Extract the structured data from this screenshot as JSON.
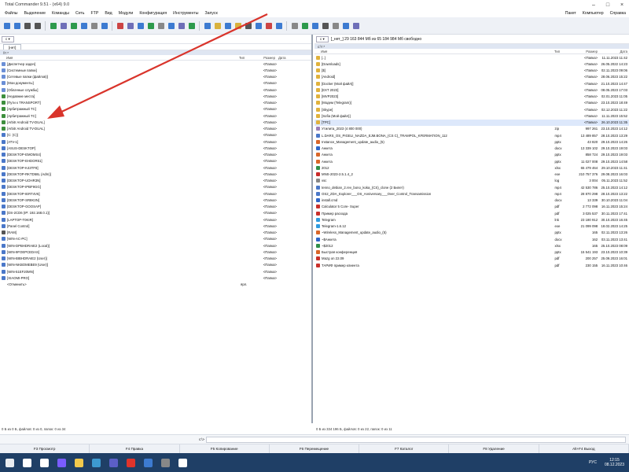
{
  "window": {
    "title": "Total Commander 9.51 - (x64) 9.0"
  },
  "menu": {
    "items": [
      "Файлы",
      "Выделение",
      "Команды",
      "Сеть",
      "FTP",
      "Вид",
      "Модули",
      "Конфигурация",
      "Инструменты",
      "Запуск"
    ],
    "right_items": [
      "Пакет",
      "Компьютер",
      "Справка"
    ]
  },
  "left": {
    "drive_label": "c",
    "path_box": "",
    "tab_label": "[нет]",
    "current_path": "\\\\*.*",
    "columns": {
      "name": "Имя",
      "ext": "Тип",
      "size": "Размер",
      "date": "Дата"
    },
    "rows": [
      {
        "name": "[Диспетчер задач]",
        "size": "<Папка>",
        "color": "#6b8fd6"
      },
      {
        "name": "[Системные папки]",
        "size": "<Папка>",
        "color": "#6b8fd6"
      },
      {
        "name": "[Сетевые папки (файлов)]",
        "size": "<Папка>",
        "color": "#6b8fd6"
      },
      {
        "name": "[Мои документы]",
        "size": "<Папка>",
        "color": "#6b8fd6"
      },
      {
        "name": "[Облачные службы]",
        "size": "<Папка>",
        "color": "#6b8fd6"
      },
      {
        "name": "[Недавние места]",
        "size": "<Папка>",
        "color": "#3e8f3e"
      },
      {
        "name": "[Пути к TRANSPORT]",
        "size": "<Папка>",
        "color": "#3e8f3e"
      },
      {
        "name": "[Арбитражный TC]",
        "size": "<Папка>",
        "color": "#3e8f3e"
      },
      {
        "name": "[Арбитражный TC]",
        "size": "<Папка>",
        "color": "#3e8f3e"
      },
      {
        "name": "[Arbitr Android TV-DUAL]",
        "size": "<Папка>",
        "color": "#3e8f3e"
      },
      {
        "name": "[Arbitr Android TV-DUAL]",
        "size": "<Папка>",
        "color": "#3e8f3e"
      },
      {
        "name": "[C: (C)]",
        "size": "<Папка>",
        "color": "#4b78c9"
      },
      {
        "name": "[ATV-1]",
        "size": "<Папка>",
        "color": "#4b78c9"
      },
      {
        "name": "[ASUS-DESKTOP]",
        "size": "<Папка>",
        "color": "#4b78c9"
      },
      {
        "name": "[DESKTOP-EMOMS4]",
        "size": "<Папка>",
        "color": "#4b78c9"
      },
      {
        "name": "[DESKTOP-EHDOR51]",
        "size": "<Папка>",
        "color": "#4b78c9"
      },
      {
        "name": "[DESKTOP-K43TF8]",
        "size": "<Папка>",
        "color": "#4b78c9"
      },
      {
        "name": "[DESKTOP-RKTD58L (Adm)]",
        "size": "<Папка>",
        "color": "#4b78c9"
      },
      {
        "name": "[DESKTOP-UOHR3N]",
        "size": "<Папка>",
        "color": "#4b78c9"
      },
      {
        "name": "[DESKTOP-IPBF9GG]",
        "size": "<Папка>",
        "color": "#4b78c9"
      },
      {
        "name": "[DESKTOP-IERT4V6]",
        "size": "<Папка>",
        "color": "#4b78c9"
      },
      {
        "name": "[DESKTOP-SR8K3N]",
        "size": "<Папка>",
        "color": "#4b78c9"
      },
      {
        "name": "[DESKTOP-GOOSAP]",
        "size": "<Папка>",
        "color": "#4b78c9"
      },
      {
        "name": "[DS-2CD6 (IP: 192.168.0.1)]",
        "size": "<Папка>",
        "color": "#4b78c9"
      },
      {
        "name": "[LAPTOP-T0KIR]",
        "size": "<Папка>",
        "color": "#4b78c9"
      },
      {
        "name": "[Panel Control]",
        "size": "<Папка>",
        "color": "#4b78c9"
      },
      {
        "name": "[RAM]",
        "size": "<Папка>",
        "color": "#555555"
      },
      {
        "name": "[WIN-AC-PC]",
        "size": "<Папка>",
        "color": "#4b78c9"
      },
      {
        "name": "[WIN-DPBHDRAIE2 (Local)]",
        "size": "<Папка>",
        "color": "#4b78c9"
      },
      {
        "name": "[WIN-9FOEPCEDAS]",
        "size": "<Папка>",
        "color": "#4b78c9"
      },
      {
        "name": "[WIN-BIBHDRAIE2 (User)]",
        "size": "<Папка>",
        "color": "#4b78c9"
      },
      {
        "name": "[WIN-NKBOMEBE9 (User)]",
        "size": "<Папка>",
        "color": "#4b78c9"
      },
      {
        "name": "[WIN-51EF20MN]",
        "size": "<Папка>",
        "color": "#4b78c9"
      },
      {
        "name": "[XIAOMI-PRO]",
        "size": "<Папка>",
        "color": "#4b78c9"
      },
      {
        "name": "<Отменить>",
        "ext": "ярл.",
        "size": "",
        "color": "#ffffff"
      }
    ],
    "status": "0 Б из 0 Б, файлов: 0 из 0, папок: 0 из 34"
  },
  "right": {
    "drive_label": "c",
    "path_box": "[_нет_] 29 163 844 Мб из 65 184 984 Мб свободно",
    "current_path": "c:\\*.*",
    "columns": {
      "name": "Имя",
      "ext": "Тип",
      "size": "Размер",
      "date": "Дата"
    },
    "rows": [
      {
        "name": "[..]",
        "ext": "",
        "size": "<Папка>",
        "date": "11.11.2023 11:42",
        "color": "#e0b23d"
      },
      {
        "name": "[Downloads]",
        "ext": "",
        "size": "<Папка>",
        "date": "26.05.2022 14:23",
        "color": "#e0b23d"
      },
      {
        "name": "[$]",
        "ext": "",
        "size": "<Папка>",
        "date": "02.11.2023 09:06",
        "color": "#e0b23d"
      },
      {
        "name": "[Android]",
        "ext": "",
        "size": "<Папка>",
        "date": "28.06.2023 15:22",
        "color": "#e0b23d"
      },
      {
        "name": "[Docker (Мой файл)]",
        "ext": "",
        "size": "<Папка>",
        "date": "21.10.2023 14:47",
        "color": "#e0b23d"
      },
      {
        "name": "[EXT 2023]",
        "ext": "",
        "size": "<Папка>",
        "date": "08.05.2023 17:03",
        "color": "#e0b23d"
      },
      {
        "name": "[MVP2023]",
        "ext": "",
        "size": "<Папка>",
        "date": "02.01.2023 11:05",
        "color": "#e0b23d"
      },
      {
        "name": "[Модем (Telegram)]",
        "ext": "",
        "size": "<Папка>",
        "date": "23.10.2023 18:49",
        "color": "#e0b23d"
      },
      {
        "name": "[Skype]",
        "ext": "",
        "size": "<Папка>",
        "date": "02.12.2023 11:22",
        "color": "#e0b23d"
      },
      {
        "name": "[Sofia (Мой файл)]",
        "ext": "",
        "size": "<Папка>",
        "date": "11.11.2023 15:52",
        "color": "#e0b23d"
      },
      {
        "name": "[TPC]",
        "ext": "",
        "size": "<Папка>",
        "date": "26.10.2023 11:35",
        "color": "#e0b23d",
        "sel": true
      },
      {
        "name": "Утилита_2023 (4 800 000)",
        "ext": "zip",
        "size": "997 261",
        "date": "23.10.2023 14:12",
        "color": "#9b7fb8"
      },
      {
        "name": "L.DARS_OS_PIGELI_NAZDA_EJM.BONA_(CS C)_TRAMPOL_KFERMATION_112",
        "ext": "mp4",
        "size": "13 489 857",
        "date": "28.10.2023 13:29",
        "color": "#4b78c9"
      },
      {
        "name": "Instance_Management_update_audio_(5)",
        "ext": "pptx",
        "size": "43 820",
        "date": "29.10.2023 14:26",
        "color": "#d9672a"
      },
      {
        "name": "Анкета",
        "ext": "docx",
        "size": "13 339 102",
        "date": "29.10.2023 19:03",
        "color": "#2f66c9"
      },
      {
        "name": "Анкета",
        "ext": "pptx",
        "size": "858 724",
        "date": "29.10.2023 19:03",
        "color": "#d9672a"
      },
      {
        "name": "Анкета",
        "ext": "pptx",
        "size": "11 027 008",
        "date": "29.10.2023 14:58",
        "color": "#d9672a"
      },
      {
        "name": "2012",
        "ext": "xlsx",
        "size": "65 479 464",
        "date": "29.10.2023 11:41",
        "color": "#2f8f4a"
      },
      {
        "name": "MNS-2023-2.5.1.4_2",
        "ext": "exe",
        "size": "210 757 376",
        "date": "29.08.2023 16:03",
        "color": "#c92b2b"
      },
      {
        "name": "vsc",
        "ext": "log",
        "size": "3 004",
        "date": "05.11.2023 11:52",
        "color": "#888888"
      },
      {
        "name": "tenno_debian_2.rev_bono_koka_(CS)_clone (2 Билет)",
        "ext": "mp4",
        "size": "42 530 786",
        "date": "25.10.2023 14:12",
        "color": "#4b78c9"
      },
      {
        "name": "OS2_ZDA_Explorer___ОS_Anniversary___Over_Control_Transamission",
        "ext": "mp4",
        "size": "28 870 298",
        "date": "28.10.2023 13:22",
        "color": "#4b78c9"
      },
      {
        "name": "install.cmd",
        "ext": "docx",
        "size": "13 339",
        "date": "30.10.2023 11:04",
        "color": "#2f66c9"
      },
      {
        "name": "Calculator 5 Core- Super",
        "ext": "pdf",
        "size": "2 772 098",
        "date": "16.11.2023 15:24",
        "color": "#c9302b"
      },
      {
        "name": "Пример расхода",
        "ext": "pdf",
        "size": "3 025 537",
        "date": "30.11.2023 17:41",
        "color": "#c9302b"
      },
      {
        "name": "Telegram",
        "ext": "lnk",
        "size": "23 180 912",
        "date": "30.10.2023 16:45",
        "color": "#2f9be0"
      },
      {
        "name": "Telegram-1.6.12",
        "ext": "exe",
        "size": "21 099 098",
        "date": "18.02.2023 14:25",
        "color": "#2f9be0"
      },
      {
        "name": "~Wireless_Management_update_audio_(5)",
        "ext": "pptx",
        "size": "165",
        "date": "02.11.2023 13:26",
        "color": "#d9672a"
      },
      {
        "name": "~$Анкета",
        "ext": "docx",
        "size": "162",
        "date": "03.11.2023 13:41",
        "color": "#2f66c9"
      },
      {
        "name": "~$2012",
        "ext": "xlsx",
        "size": "165",
        "date": "25.10.2023 08:09",
        "color": "#2f8f4a"
      },
      {
        "name": "Быстрая конференция",
        "ext": "pptx",
        "size": "15 541 193",
        "date": "23.10.2023 10:39",
        "color": "#d9672a"
      },
      {
        "name": "Mazg on 22.09",
        "ext": "pdf",
        "size": "200 257",
        "date": "25.09.2023 16:01",
        "color": "#c9302b"
      },
      {
        "name": "ТАРИФ пример клиента",
        "ext": "pdf",
        "size": "230 155",
        "date": "16.11.2023 10:46",
        "color": "#c9302b"
      }
    ],
    "status": "0 Б из 334 196 Б, файлов: 0 из 22, папок: 0 из 11"
  },
  "cmdline": {
    "label": "c:\\>",
    "value": ""
  },
  "fkeys": [
    "F3 Просмотр",
    "F4 Правка",
    "F5 Копирование",
    "F6 Перемещение",
    "F7 Каталог",
    "F8 Удаление",
    "Alt+F4 Выход"
  ],
  "taskbar": {
    "time": "12:15",
    "date": "08.12.2023",
    "lang": "РУС"
  },
  "colors": {
    "arrow": "#d9342b",
    "taskbar": "#1f3f66",
    "selection": "#dde8fb"
  }
}
